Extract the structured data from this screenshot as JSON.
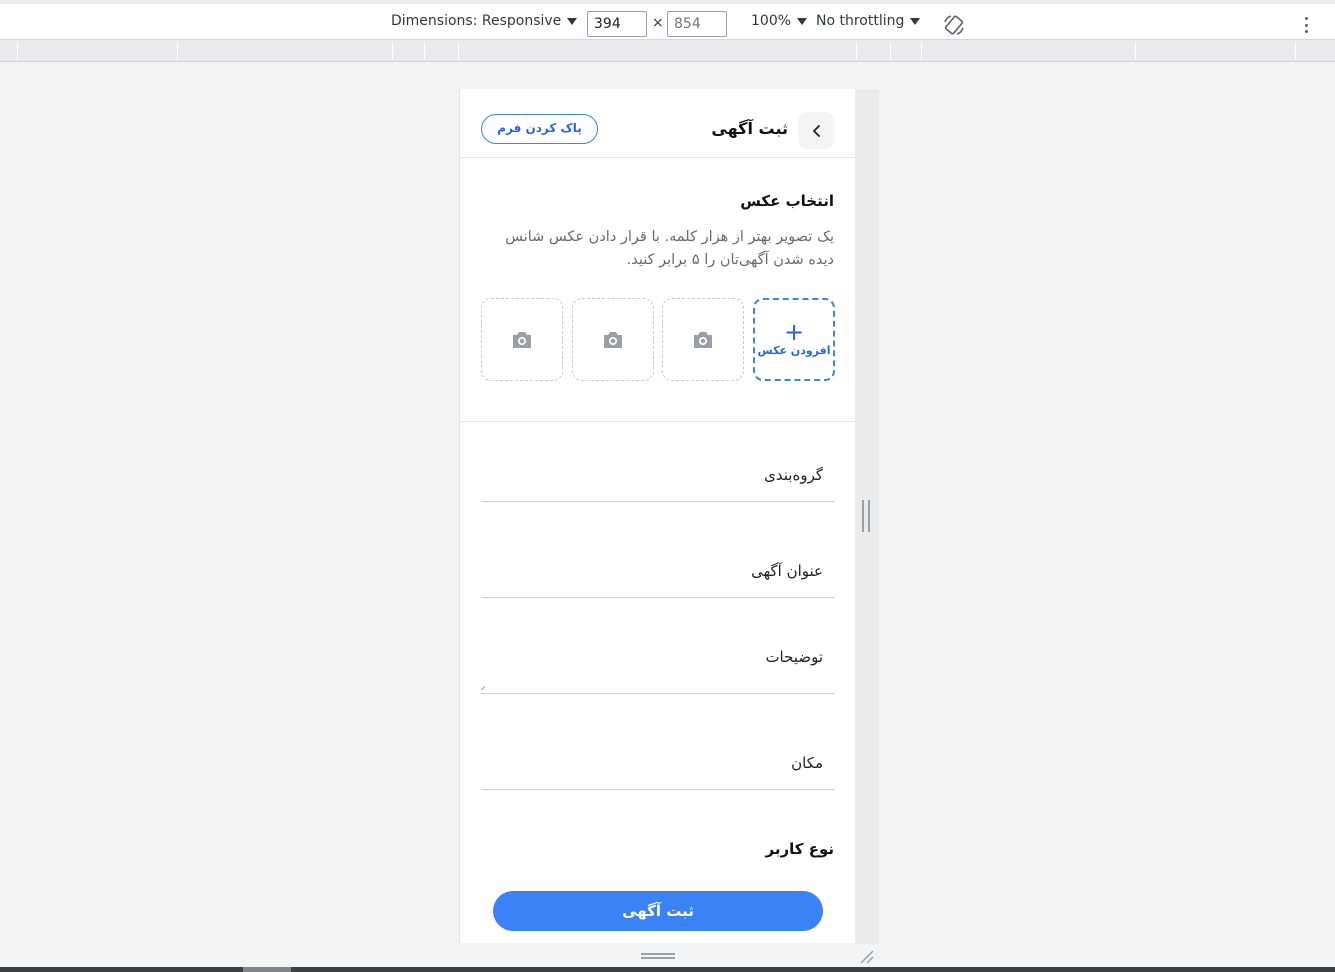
{
  "devtools": {
    "dimensions_label": "Dimensions: Responsive",
    "width_value": "394",
    "height_placeholder": "854",
    "times": "×",
    "zoom": "100%",
    "throttling": "No throttling",
    "icons": [
      "caret-down-icon",
      "rotate-icon",
      "more-vert-icon"
    ]
  },
  "app": {
    "title": "ثبت آگهی",
    "clear_button": "پاک کردن فرم",
    "photo_section": {
      "title": "انتخاب عکس",
      "description": "یک تصویر بهتر از هزار کلمه. با قرار دادن عکس شانس دیده شدن آگهی‌تان را ۵ برابر کنید.",
      "add_plus": "+",
      "add_label": "افزودن عکس"
    },
    "fields": {
      "category": "گروه‌بندی",
      "ad_title": "عنوان آگهی",
      "description": "توضیحات",
      "location": "مکان"
    },
    "user_type_label": "نوع کاربر",
    "submit_button": "ثبت آگهی",
    "colors": {
      "accent": "#3b82f6",
      "accent_text": "#2563eb"
    }
  }
}
